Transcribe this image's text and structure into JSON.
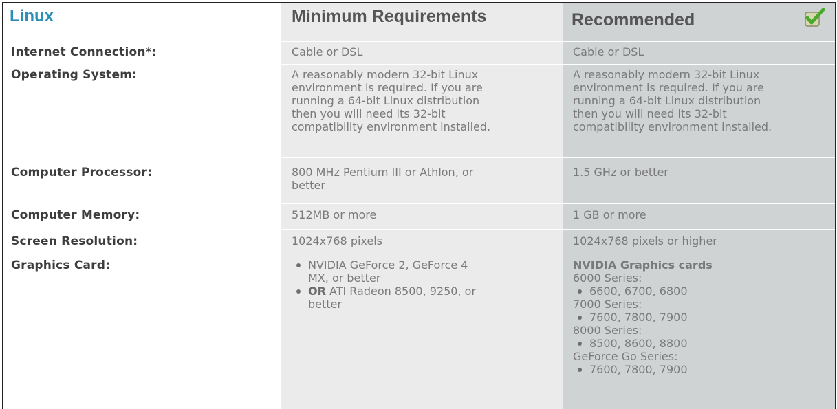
{
  "header": {
    "platform": "Linux",
    "minimum": "Minimum Requirements",
    "recommended": "Recommended"
  },
  "rows": [
    {
      "label": "Internet Connection*:",
      "min": "Cable or DSL",
      "rec": "Cable or DSL"
    },
    {
      "label": "Operating System:",
      "min_lines": [
        "A reasonably modern 32-bit Linux",
        "environment is required. If you are",
        "running a 64-bit Linux distribution",
        "then you will need its 32-bit",
        "compatibility environment installed."
      ],
      "rec_lines": [
        "A reasonably modern 32-bit Linux",
        "environment is required. If you are",
        "running a 64-bit Linux distribution",
        "then you will need its 32-bit",
        "compatibility environment installed."
      ]
    },
    {
      "label": "Computer Processor:",
      "min_lines": [
        "800 MHz Pentium III or Athlon, or",
        "better"
      ],
      "rec": "1.5 GHz or better"
    },
    {
      "label": "Computer Memory:",
      "min": "512MB or more",
      "rec": "1 GB or more"
    },
    {
      "label": "Screen Resolution:",
      "min": "1024x768 pixels",
      "rec": "1024x768 pixels or higher"
    },
    {
      "label": "Graphics Card:",
      "min_items": [
        {
          "lines": [
            "NVIDIA GeForce 2, GeForce 4",
            "MX, or better"
          ]
        },
        {
          "bold": "OR",
          "lines": [
            " ATI Radeon 8500, 9250, or",
            "better"
          ]
        }
      ],
      "rec_title": "NVIDIA Graphics cards",
      "rec_groups": [
        {
          "series": "6000 Series:",
          "models": "6600, 6700, 6800"
        },
        {
          "series": "7000 Series:",
          "models": "7600, 7800, 7900"
        },
        {
          "series": "8000 Series:",
          "models": "8500, 8600, 8800"
        },
        {
          "series": "GeForce Go Series:",
          "models": "7600, 7800, 7900"
        }
      ]
    }
  ],
  "colors": {
    "accent": "#2a8fb8",
    "min_column_bg": "#ebebeb",
    "rec_column_bg": "#cfd3d4",
    "check_green": "#5cb82e"
  },
  "icons": {
    "recommended_check": "checkmark-icon"
  }
}
